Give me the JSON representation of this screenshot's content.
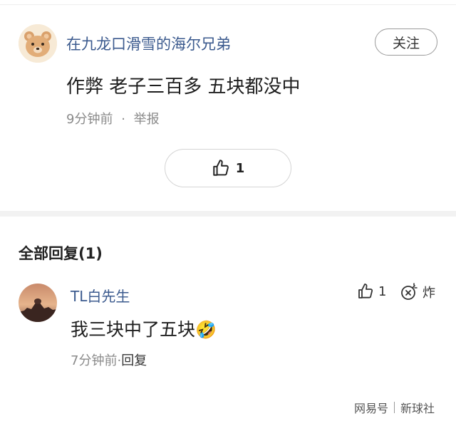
{
  "post": {
    "username": "在九龙口滑雪的海尔兄弟",
    "follow_label": "关注",
    "text": "作弊 老子三百多 五块都没中",
    "time": "9分钟前",
    "separator": "·",
    "report_label": "举报",
    "like_count": "1"
  },
  "replies": {
    "title": "全部回复(1)",
    "items": [
      {
        "username": "TL白先生",
        "text": "我三块中了五块",
        "emoji": "🤣",
        "time": "7分钟前",
        "separator": "·",
        "reply_label": "回复",
        "like_count": "1",
        "bomb_label": "炸"
      }
    ]
  },
  "watermark": {
    "left": "网易号",
    "right": "新球社"
  },
  "colors": {
    "username": "#3b5a8e",
    "meta": "#8a8a8a",
    "divider": "#f2f2f2"
  }
}
